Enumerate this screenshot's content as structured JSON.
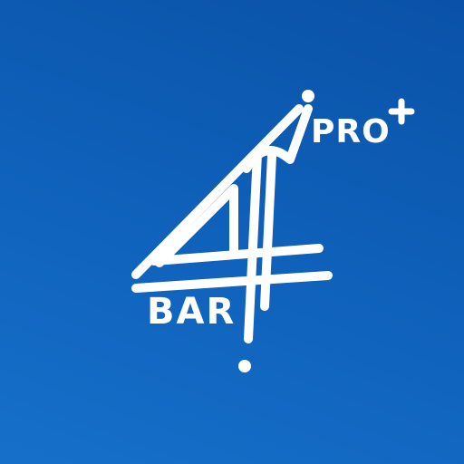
{
  "logo": {
    "word_pro": "PRO",
    "word_bar": "BAR",
    "background_top_color": "#0a52a8",
    "background_bottom_color": "#1670ca",
    "mark_color": "#ffffff"
  }
}
